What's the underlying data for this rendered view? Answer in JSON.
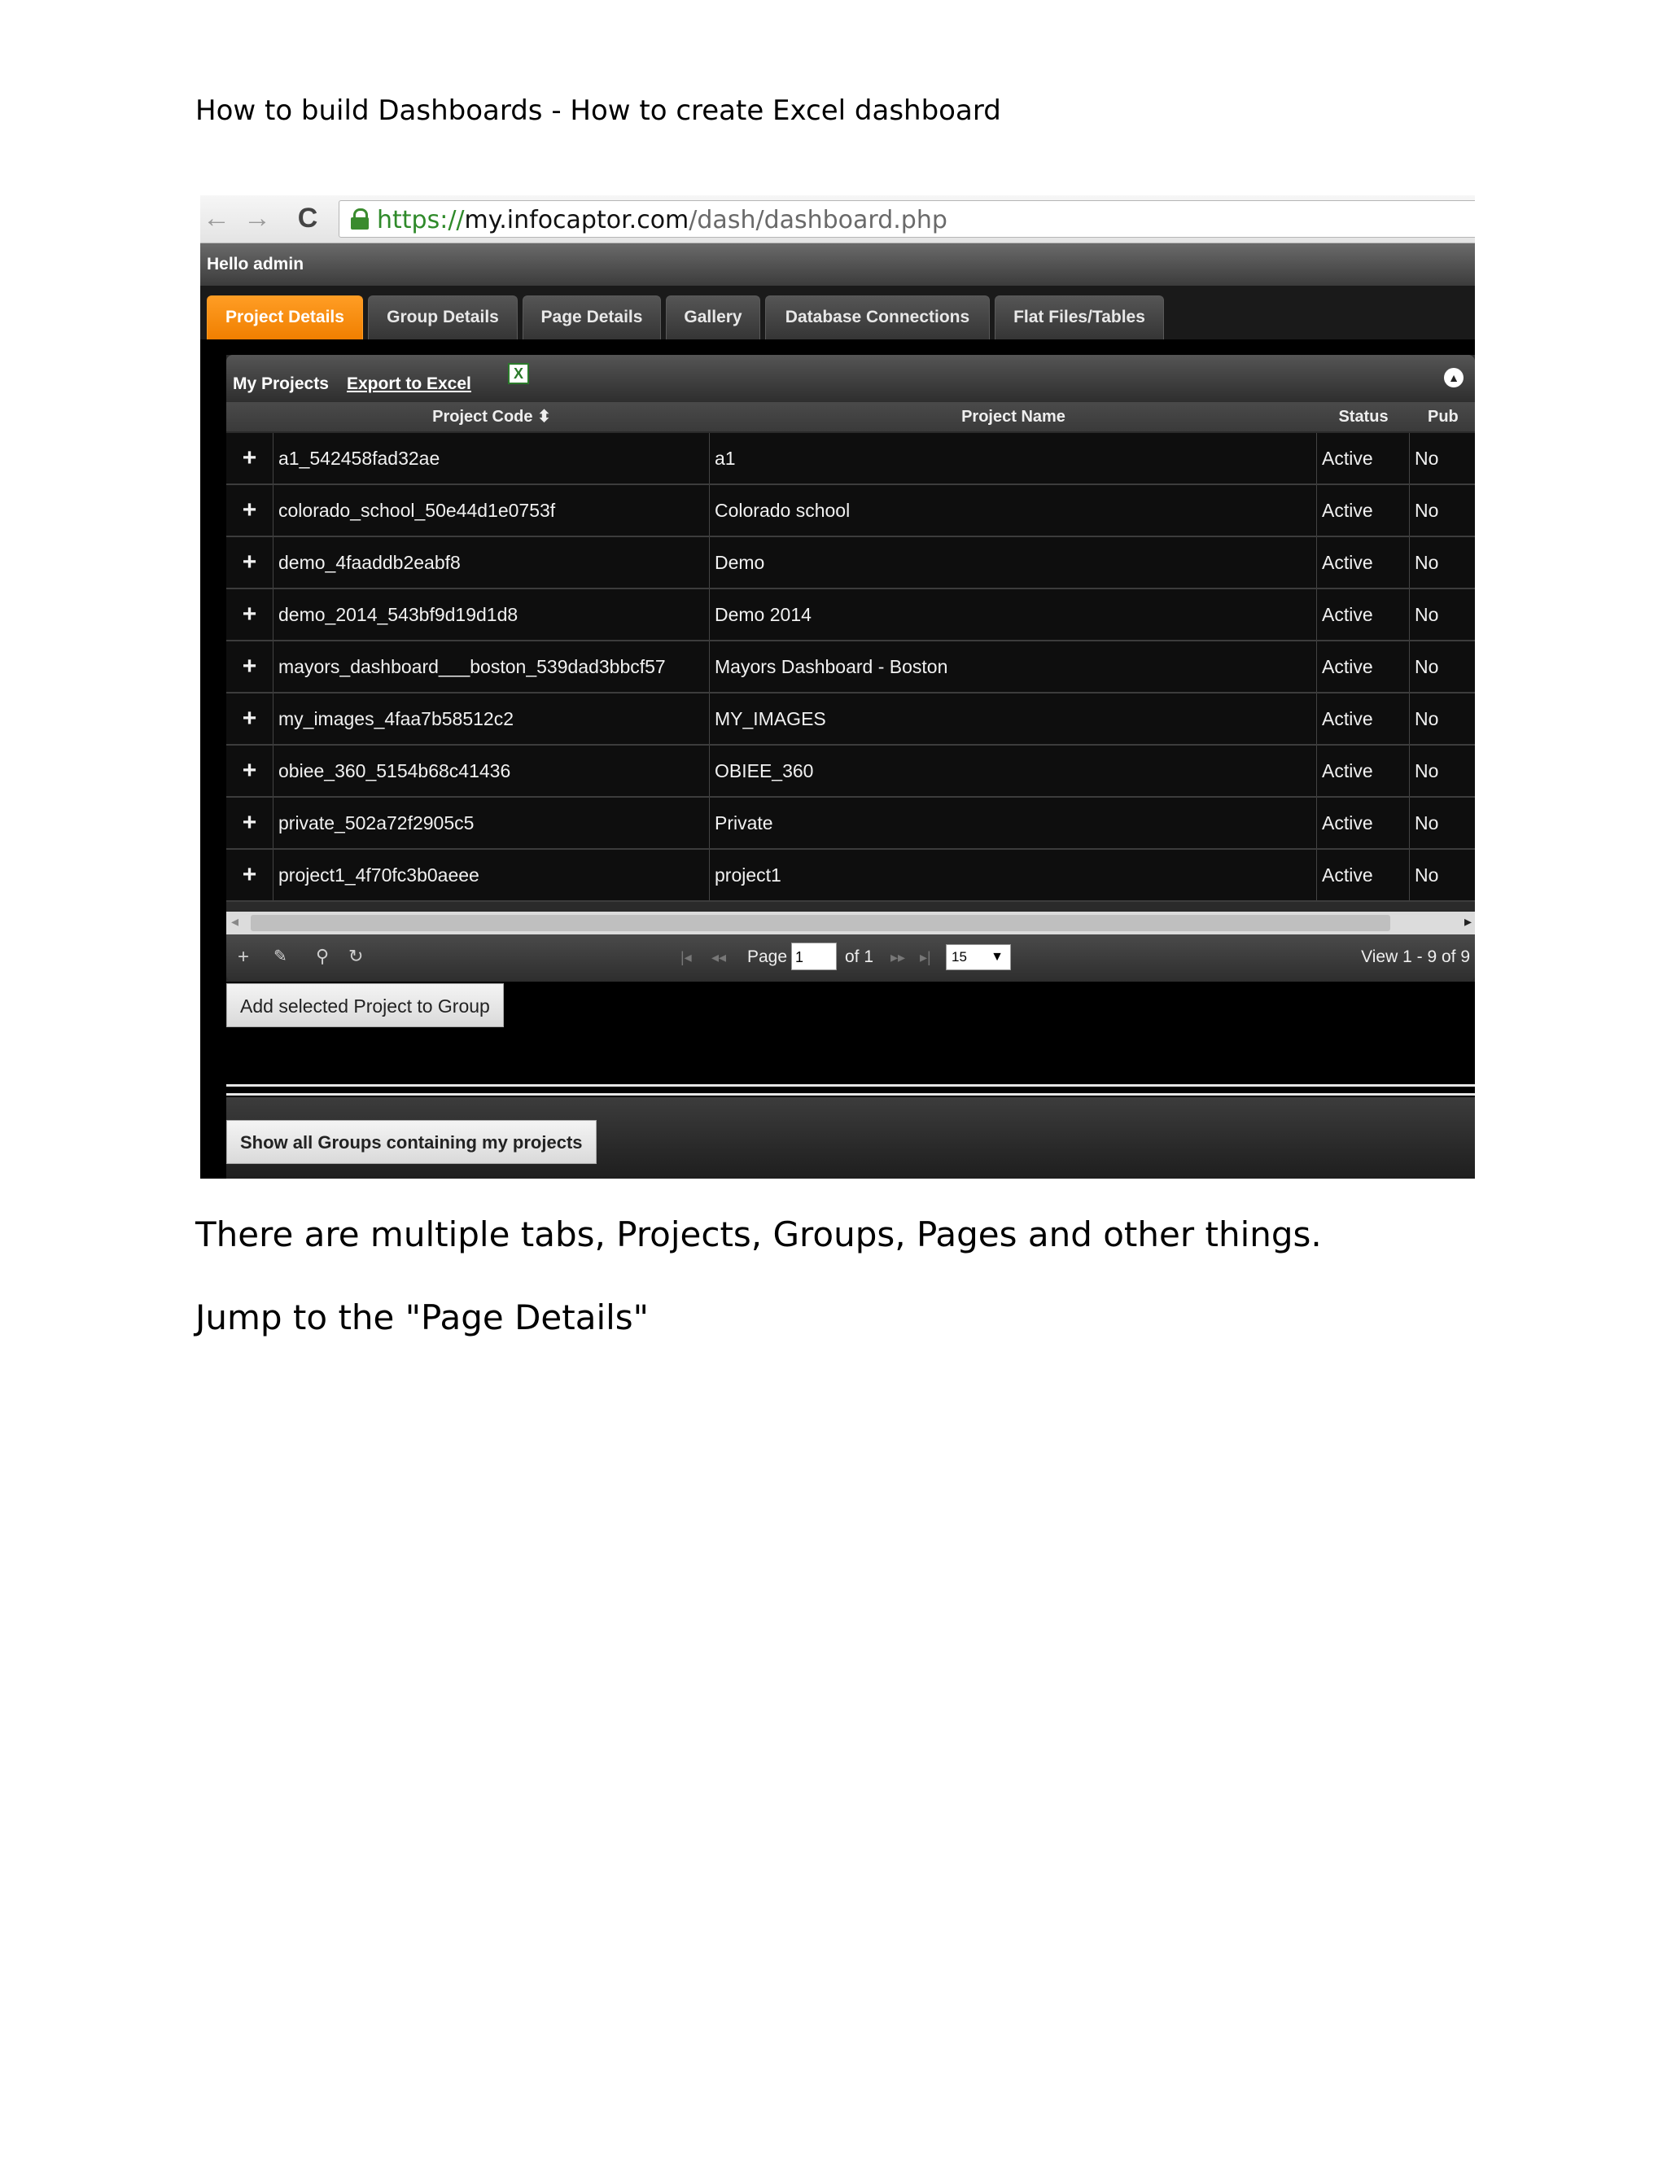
{
  "document": {
    "heading": "How to build Dashboards - How to create Excel dashboard",
    "paragraphs": [
      "There are multiple tabs, Projects, Groups, Pages and other things.",
      "Jump to the \"Page Details\""
    ]
  },
  "browser": {
    "url_scheme": "https://",
    "url_host": "my.infocaptor.com",
    "url_path": "/dash/dashboard.php",
    "back_glyph": "←",
    "forward_glyph": "→",
    "reload_glyph": "C"
  },
  "app": {
    "greeting": "Hello admin",
    "tabs": [
      {
        "label": "Project Details",
        "active": true
      },
      {
        "label": "Group Details",
        "active": false
      },
      {
        "label": "Page Details",
        "active": false
      },
      {
        "label": "Gallery",
        "active": false
      },
      {
        "label": "Database Connections",
        "active": false
      },
      {
        "label": "Flat Files/Tables",
        "active": false
      }
    ],
    "accent_color": "#f58a0b"
  },
  "grid": {
    "title": "My Projects",
    "export_label": "Export to Excel",
    "excel_glyph": "X",
    "collapse_glyph": "▲",
    "columns": {
      "code": "Project Code ⬍",
      "name": "Project Name",
      "status": "Status",
      "pub": "Pub"
    },
    "expand_glyph": "+",
    "rows": [
      {
        "code": "a1_542458fad32ae",
        "name": "a1",
        "status": "Active",
        "pub": "No"
      },
      {
        "code": "colorado_school_50e44d1e0753f",
        "name": "Colorado school",
        "status": "Active",
        "pub": "No"
      },
      {
        "code": "demo_4faaddb2eabf8",
        "name": "Demo",
        "status": "Active",
        "pub": "No"
      },
      {
        "code": "demo_2014_543bf9d19d1d8",
        "name": "Demo 2014",
        "status": "Active",
        "pub": "No"
      },
      {
        "code": "mayors_dashboard___boston_539dad3bbcf57",
        "name": "Mayors Dashboard - Boston",
        "status": "Active",
        "pub": "No"
      },
      {
        "code": "my_images_4faa7b58512c2",
        "name": "MY_IMAGES",
        "status": "Active",
        "pub": "No"
      },
      {
        "code": "obiee_360_5154b68c41436",
        "name": "OBIEE_360",
        "status": "Active",
        "pub": "No"
      },
      {
        "code": "private_502a72f2905c5",
        "name": "Private",
        "status": "Active",
        "pub": "No"
      },
      {
        "code": "project1_4f70fc3b0aeee",
        "name": "project1",
        "status": "Active",
        "pub": "No"
      }
    ],
    "pager": {
      "add_glyph": "+",
      "edit_glyph": "✎",
      "search_glyph": "⚲",
      "refresh_glyph": "↻",
      "first_glyph": "|◂",
      "prev_glyph": "◂◂",
      "next_glyph": "▸▸",
      "last_glyph": "▸|",
      "page_label": "Page",
      "page_value": "1",
      "of_label": "of 1",
      "rows_per_page": "15",
      "select_arrow": "▼",
      "view_count": "View 1 - 9 of 9"
    },
    "scroll_left_glyph": "◂",
    "scroll_right_glyph": "▸"
  },
  "actions": {
    "add_to_group": "Add selected Project to Group",
    "show_groups": "Show all Groups containing my projects"
  }
}
